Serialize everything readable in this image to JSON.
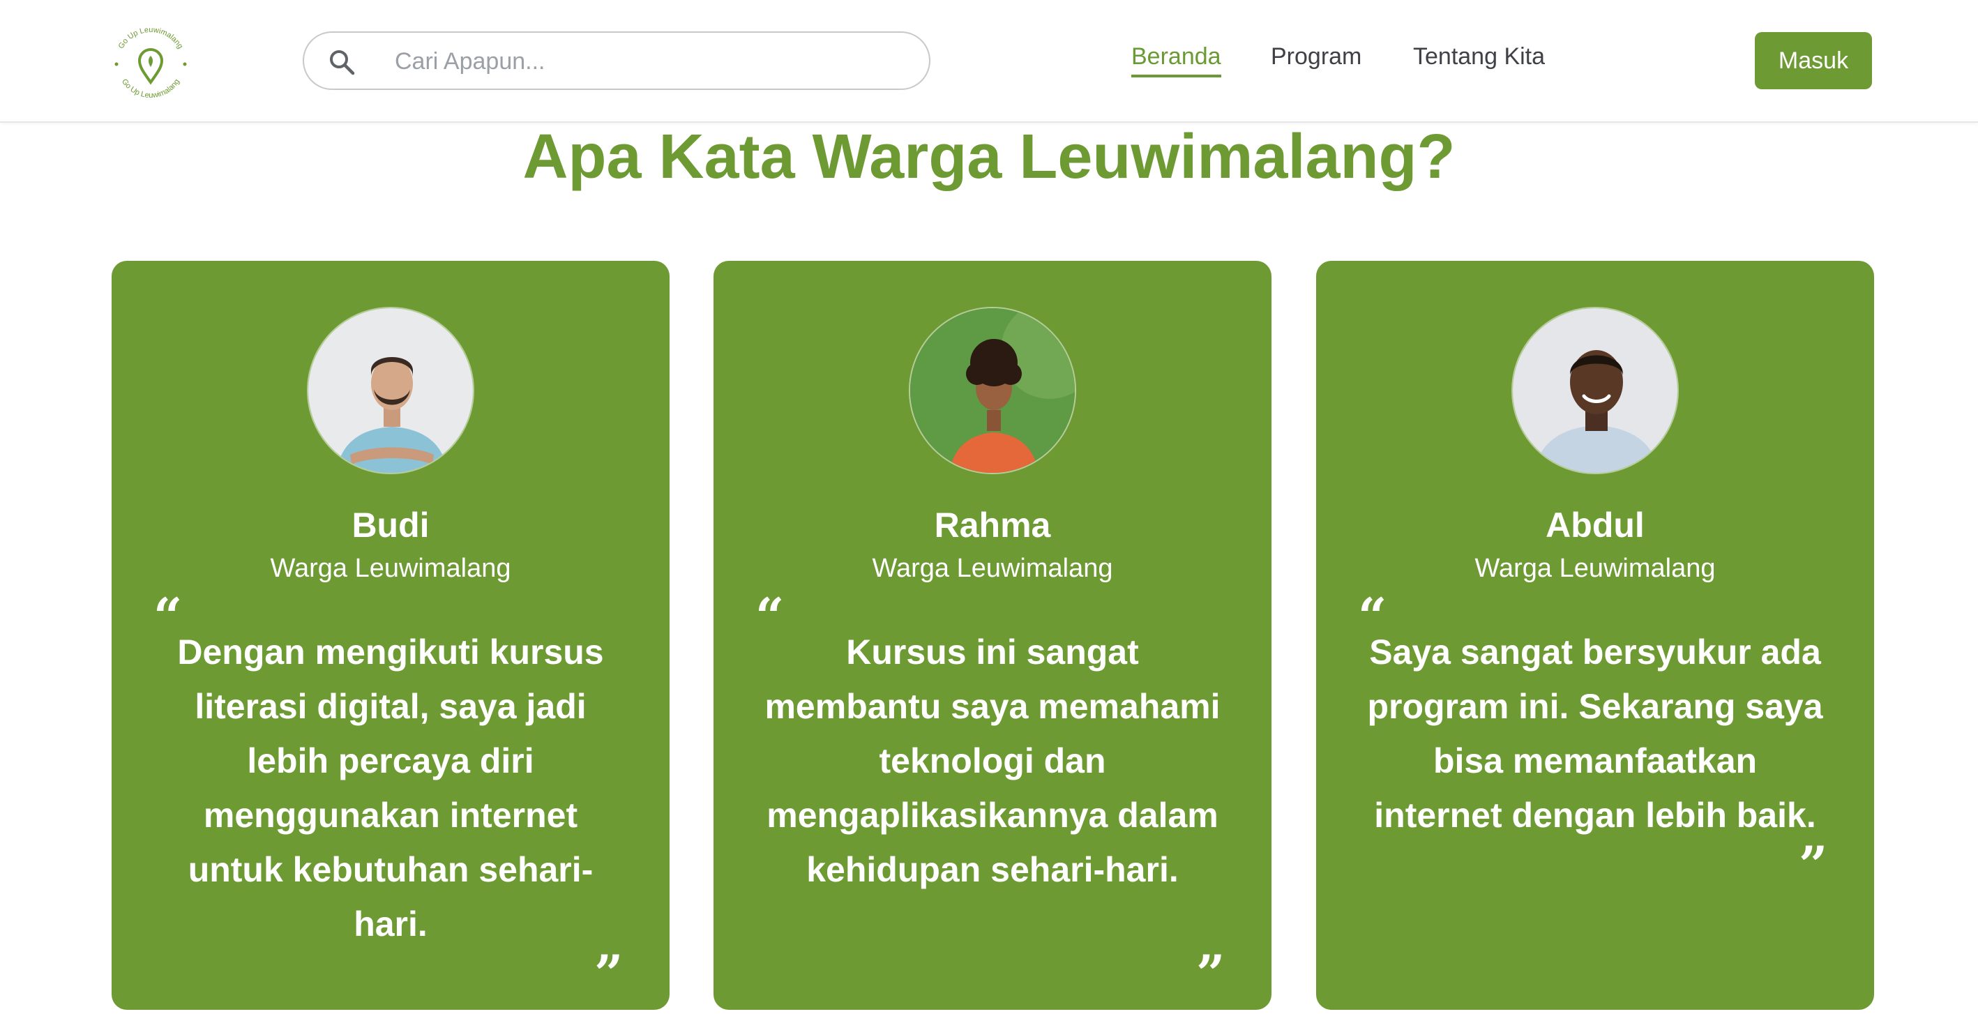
{
  "header": {
    "logo_text": "Go Up Leuwimalang",
    "search": {
      "placeholder": "Cari Apapun..."
    },
    "nav": [
      {
        "label": "Beranda",
        "active": true
      },
      {
        "label": "Program"
      },
      {
        "label": "Tentang Kita"
      }
    ],
    "login_label": "Masuk"
  },
  "section": {
    "title_bold": "Apa Kata",
    "title_rest": " Warga Leuwimalang?"
  },
  "testimonials": [
    {
      "name": "Budi",
      "role": "Warga Leuwimalang",
      "quote": "Dengan mengikuti kursus literasi digital, saya jadi lebih percaya diri menggunakan internet untuk kebutuhan sehari-hari."
    },
    {
      "name": "Rahma",
      "role": "Warga Leuwimalang",
      "quote": "Kursus ini sangat membantu saya memahami teknologi dan mengaplikasikannya dalam kehidupan sehari-hari."
    },
    {
      "name": "Abdul",
      "role": "Warga Leuwimalang",
      "quote": "Saya sangat bersyukur ada program ini. Sekarang saya bisa memanfaatkan internet dengan lebih baik."
    }
  ],
  "quote_marks": {
    "open": "“",
    "close": "”"
  },
  "colors": {
    "brand_green": "#6d9a33",
    "nav_text": "#3f4147",
    "white": "#ffffff"
  }
}
